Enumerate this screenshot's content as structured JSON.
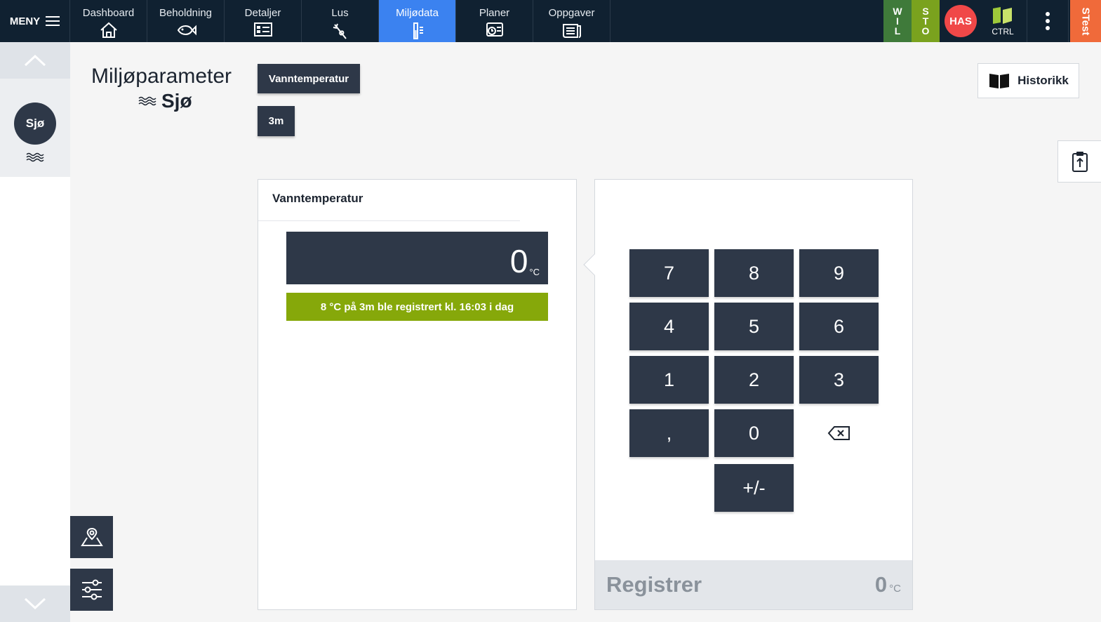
{
  "topbar": {
    "menu_label": "MENY",
    "tabs": [
      {
        "label": "Dashboard",
        "icon": "home-icon"
      },
      {
        "label": "Beholdning",
        "icon": "fish-icon"
      },
      {
        "label": "Detaljer",
        "icon": "details-card-icon"
      },
      {
        "label": "Lus",
        "icon": "lice-icon"
      },
      {
        "label": "Miljødata",
        "icon": "thermometer-icon",
        "active": true
      },
      {
        "label": "Planer",
        "icon": "plans-icon"
      },
      {
        "label": "Oppgaver",
        "icon": "tasks-icon"
      }
    ],
    "tag_wil": [
      "W",
      "I",
      "L"
    ],
    "tag_sto": [
      "S",
      "T",
      "O"
    ],
    "user_initials": "HAS",
    "ctrl_label": "CTRL",
    "env_label": "STest"
  },
  "sidebar": {
    "location_label": "Sjø"
  },
  "header": {
    "title": "Miljøparameter",
    "subtitle": "Sjø",
    "parameter_chip": "Vanntemperatur",
    "depth_chip": "3m",
    "history_label": "Historikk"
  },
  "panel": {
    "title": "Vanntemperatur",
    "display_value": "0",
    "unit": "°C",
    "status_message": "8 °C på 3m ble registrert kl. 16:03 i dag"
  },
  "keypad": {
    "keys": [
      "7",
      "8",
      "9",
      "4",
      "5",
      "6",
      "1",
      "2",
      "3",
      ",",
      "0"
    ],
    "sign_key": "+/-",
    "register_label": "Registrer",
    "register_value": "0",
    "register_unit": "°C"
  },
  "colors": {
    "topbar": "#102131",
    "active_tab": "#3b82f0",
    "dark_button": "#2e3848",
    "status_green": "#86a80a",
    "user_badge": "#f04848",
    "env_badge": "#f06a3a"
  }
}
